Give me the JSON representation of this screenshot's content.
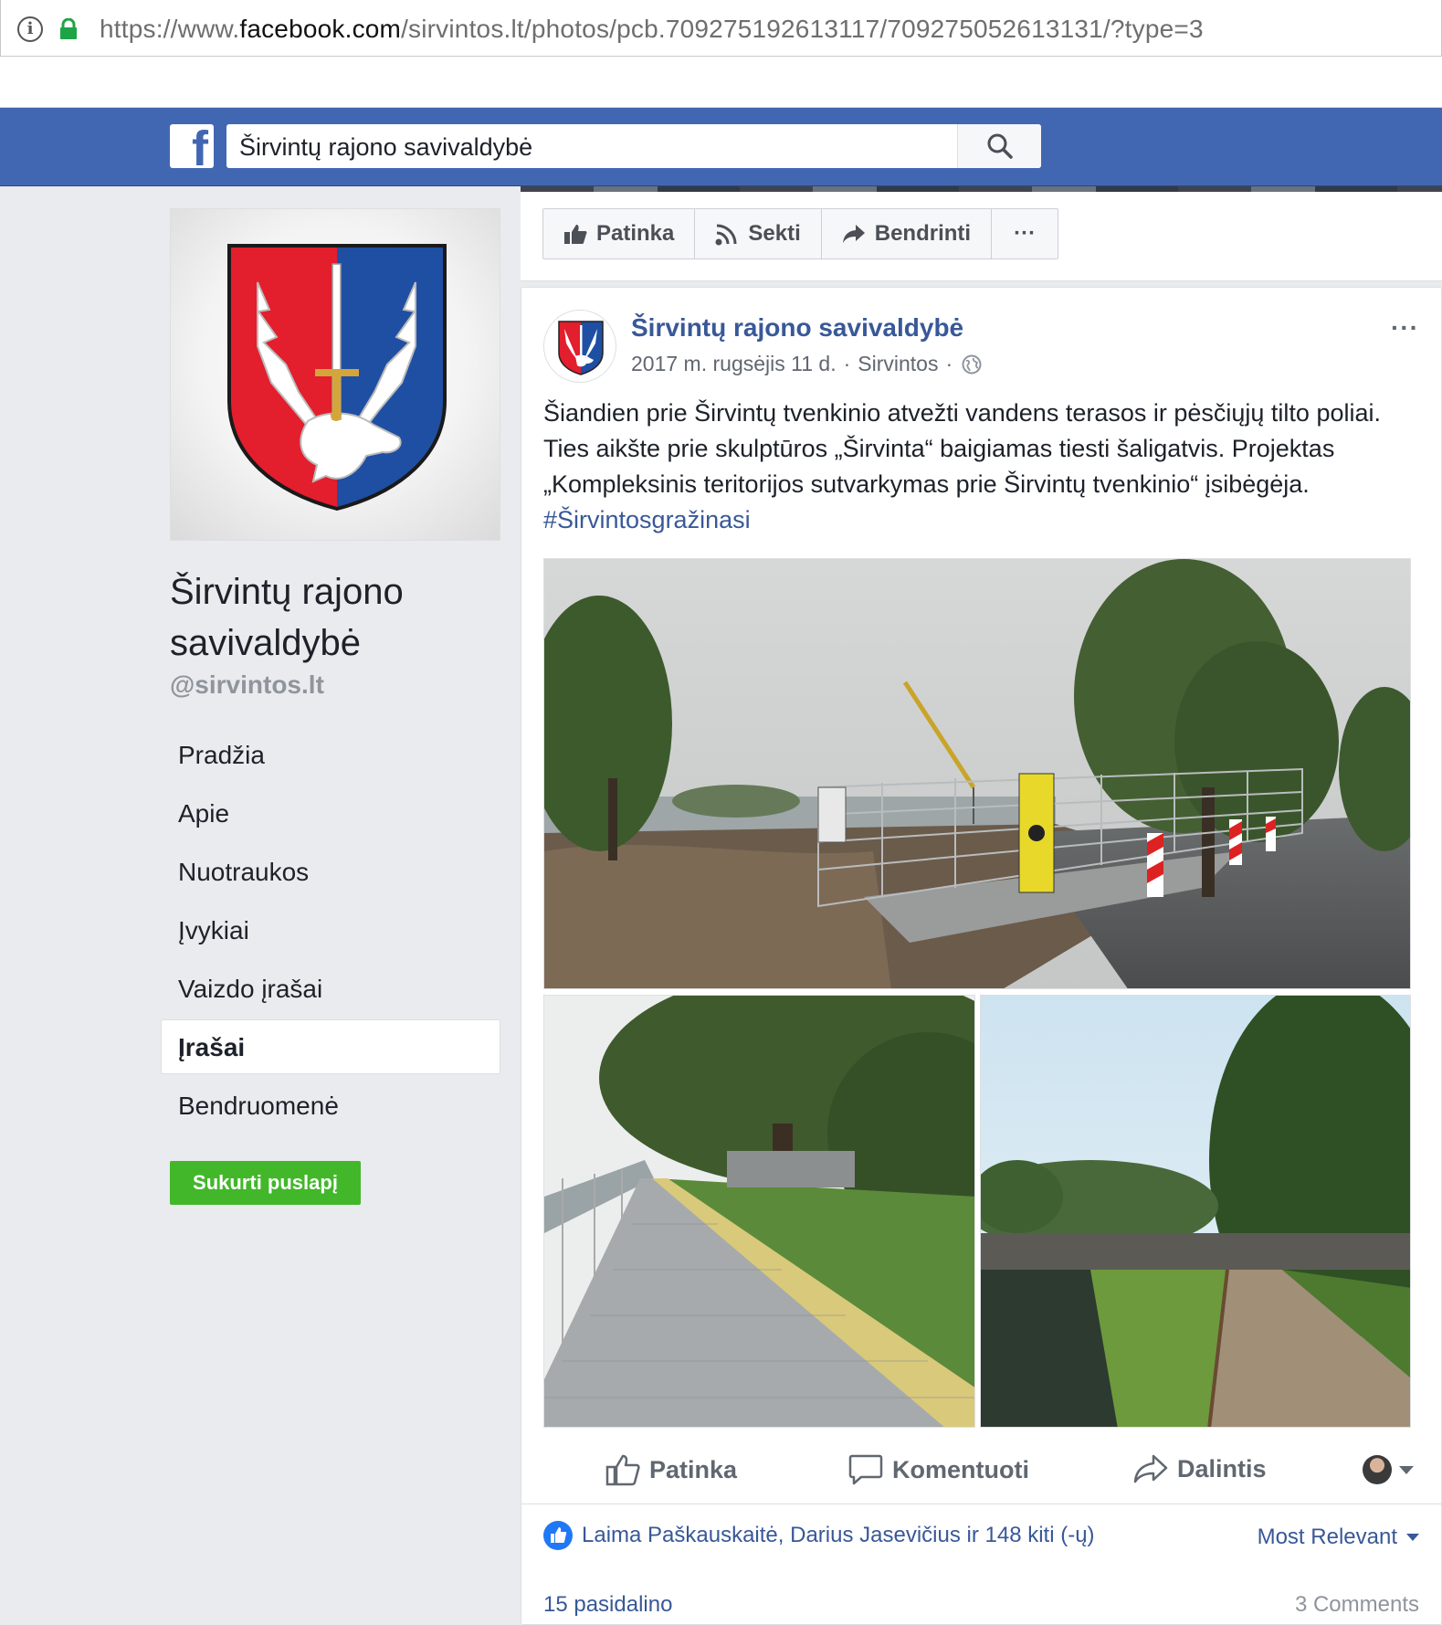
{
  "browser": {
    "url_prefix": "https://www.",
    "url_domain": "facebook.com",
    "url_path": "/sirvintos.lt/photos/pcb.709275192613117/709275052613131/?type=3"
  },
  "topbar": {
    "logo_letter": "f",
    "search_value": "Širvintų rajono savivaldybė"
  },
  "sidebar": {
    "page_name": "Širvintų rajono savivaldybė",
    "handle": "@sirvintos.lt",
    "nav": [
      {
        "label": "Pradžia",
        "active": false
      },
      {
        "label": "Apie",
        "active": false
      },
      {
        "label": "Nuotraukos",
        "active": false
      },
      {
        "label": "Įvykiai",
        "active": false
      },
      {
        "label": "Vaizdo įrašai",
        "active": false
      },
      {
        "label": "Įrašai",
        "active": true
      },
      {
        "label": "Bendruomenė",
        "active": false
      }
    ],
    "create_page_label": "Sukurti puslapį"
  },
  "actions": {
    "like": "Patinka",
    "follow": "Sekti",
    "share": "Bendrinti",
    "more": "···"
  },
  "post": {
    "author": "Širvintų rajono savivaldybė",
    "date": "2017 m. rugsėjis 11 d.",
    "location": "Sirvintos",
    "separator": "·",
    "menu": "···",
    "text": "Šiandien prie Širvintų tvenkinio atvežti vandens terasos ir pėsčiųjų tilto poliai. Ties aikšte prie skulptūros „Širvinta“ baigiamas tiesti šaligatvis. Projektas „Kompleksinis teritorijos sutvarkymas prie Širvintų tvenkinio“ įsibėgėja.",
    "hashtag": "#Širvintosgražinasi",
    "like_label": "Patinka",
    "comment_label": "Komentuoti",
    "share_label": "Dalintis",
    "likes_summary": "Laima Paškauskaitė, Darius Jasevičius ir 148 kiti (-ų)",
    "sort_label": "Most Relevant",
    "shares": "15 pasidalino",
    "comments": "3 Comments"
  },
  "colors": {
    "fb_blue": "#4267b2",
    "link": "#385898",
    "green": "#42b72a",
    "shield_red": "#e31e2d",
    "shield_blue": "#1f4fa3"
  }
}
